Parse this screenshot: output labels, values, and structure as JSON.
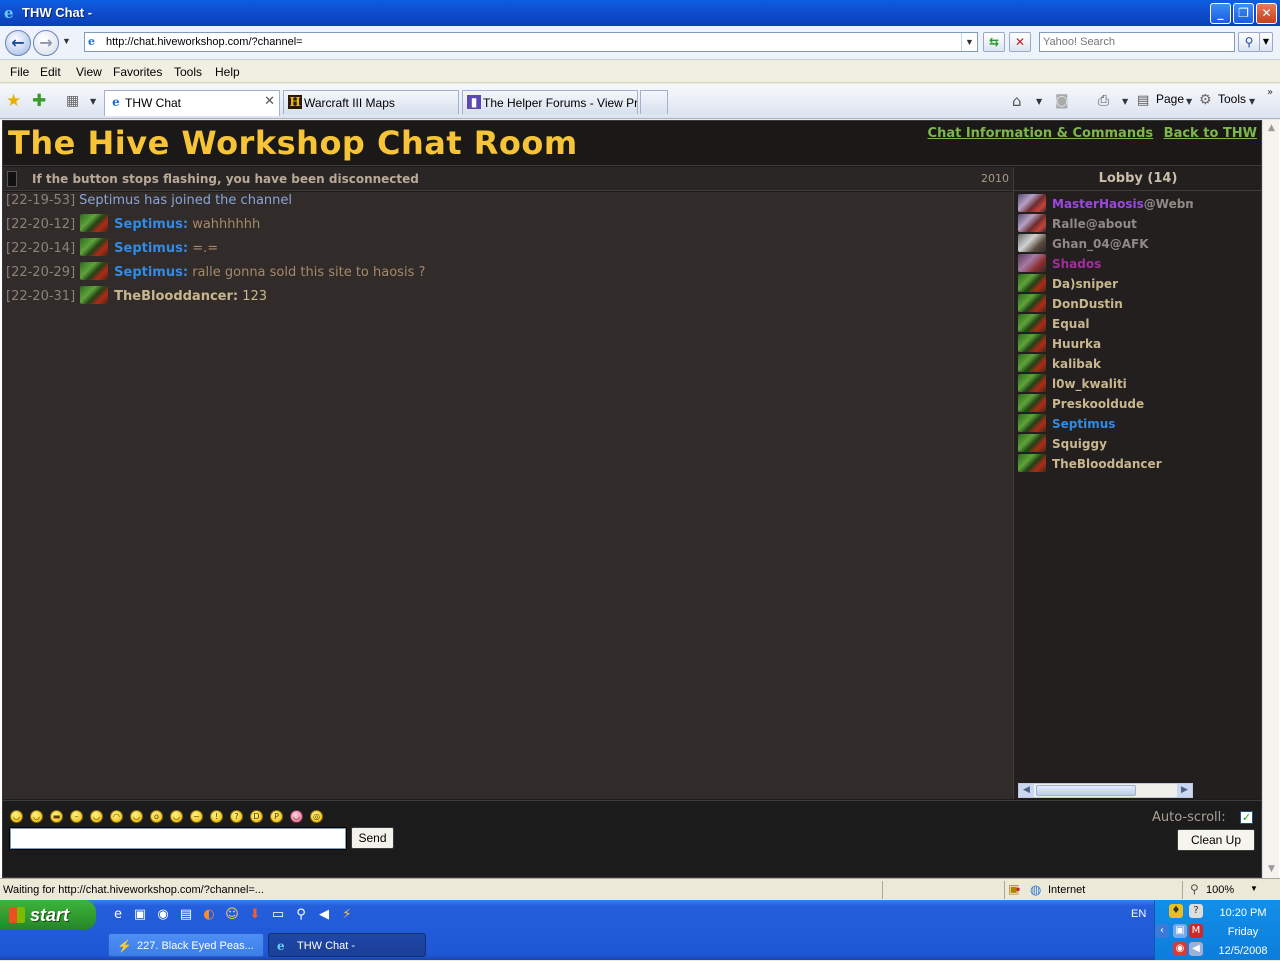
{
  "window": {
    "title": "THW Chat -"
  },
  "browser": {
    "url": "http://chat.hiveworkshop.com/?channel=",
    "search_placeholder": "Yahoo! Search",
    "menu": [
      "File",
      "Edit",
      "View",
      "Favorites",
      "Tools",
      "Help"
    ],
    "tabs": [
      {
        "label": "THW Chat",
        "icon": "ie-page-icon",
        "active": true
      },
      {
        "label": "Warcraft III Maps",
        "icon": "hive-icon",
        "active": false
      },
      {
        "label": "The Helper Forums - View Pr...",
        "icon": "forum-icon",
        "active": false
      }
    ],
    "commands": {
      "page": "Page",
      "tools": "Tools"
    },
    "status_text": "Waiting for http://chat.hiveworkshop.com/?channel=...",
    "zone": "Internet",
    "zoom": "100%"
  },
  "chat": {
    "room_title": "The Hive Workshop Chat Room",
    "links": [
      "Chat Information & Commands",
      "Back to THW"
    ],
    "status_message": "If the button stops flashing, you have been disconnected",
    "status_number": "2010",
    "lobby_title": "Lobby (14)",
    "messages": [
      {
        "time": "[22-19-53]",
        "type": "system",
        "text": "Septimus has joined the channel"
      },
      {
        "time": "[22-20-12]",
        "type": "user",
        "nick": "Septimus:",
        "text": "wahhhhhh"
      },
      {
        "time": "[22-20-14]",
        "type": "user",
        "nick": "Septimus:",
        "text": "=.="
      },
      {
        "time": "[22-20-29]",
        "type": "user",
        "nick": "Septimus:",
        "text": "ralle gonna sold this site to haosis ?"
      },
      {
        "time": "[22-20-31]",
        "type": "user",
        "nick": "TheBlooddancer:",
        "text": "123"
      }
    ],
    "users": [
      {
        "name": "MasterHaosis",
        "suffix": "@Webma",
        "color": "#9b48e0"
      },
      {
        "name": "Ralle",
        "suffix": "@about",
        "color": "#8f8a85"
      },
      {
        "name": "Ghan_04",
        "suffix": "@AFK",
        "color": "#8f8a85"
      },
      {
        "name": "Shados",
        "suffix": "",
        "color": "#a32c9e"
      },
      {
        "name": "Da)sniper",
        "suffix": "",
        "color": "#c8b78e"
      },
      {
        "name": "DonDustin",
        "suffix": "",
        "color": "#c8b78e"
      },
      {
        "name": "Equal",
        "suffix": "",
        "color": "#c8b78e"
      },
      {
        "name": "Huurka",
        "suffix": "",
        "color": "#c8b78e"
      },
      {
        "name": "kalibak",
        "suffix": "",
        "color": "#c8b78e"
      },
      {
        "name": "l0w_kwaliti",
        "suffix": "",
        "color": "#c8b78e"
      },
      {
        "name": "Preskooldude",
        "suffix": "",
        "color": "#c8b78e"
      },
      {
        "name": "Septimus",
        "suffix": "",
        "color": "#2f8be6"
      },
      {
        "name": "Squiggy",
        "suffix": "",
        "color": "#c8b78e"
      },
      {
        "name": "TheBlooddancer",
        "suffix": "",
        "color": "#c8b78e"
      }
    ],
    "send_label": "Send",
    "autoscroll_label": "Auto-scroll:",
    "autoscroll_checked": true,
    "cleanup_label": "Clean Up",
    "input_value": ""
  },
  "taskbar": {
    "start_label": "start",
    "tasks": [
      {
        "label": "227. Black Eyed Peas...",
        "active": false
      },
      {
        "label": "THW Chat -",
        "active": true
      }
    ],
    "language": "EN",
    "clock": {
      "time": "10:20 PM",
      "day": "Friday",
      "date": "12/5/2008"
    }
  },
  "colors": {
    "title_gold": "#f7c437",
    "link_green": "#7fb84a",
    "nick_blue": "#2f8be6",
    "chat_bg": "#312b29"
  }
}
